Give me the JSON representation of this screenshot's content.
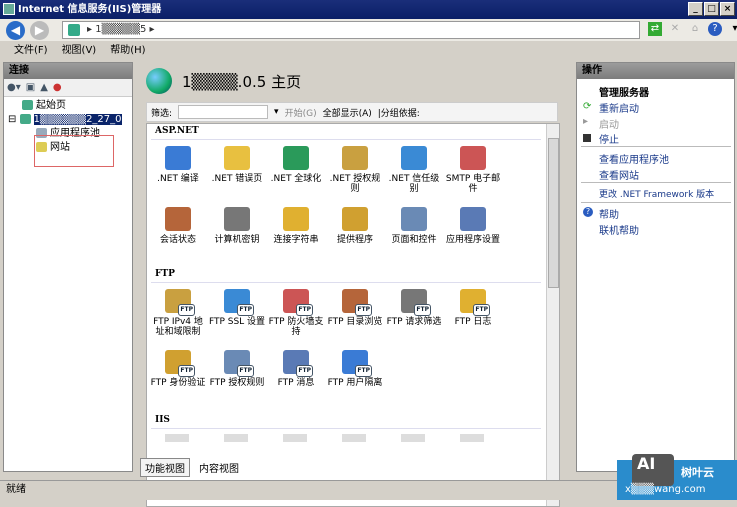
{
  "window": {
    "title": "Internet 信息服务(IIS)管理器",
    "minimize": "_",
    "maximize": "□",
    "close": "×"
  },
  "address": {
    "path": "1▒▒▒▒▒5 ▸"
  },
  "menu": [
    "文件(F)",
    "视图(V)",
    "帮助(H)"
  ],
  "left": {
    "header": "连接",
    "tree": [
      "起始页",
      "1▒▒▒▒▒▒2_27_0",
      "应用程序池",
      "网站"
    ]
  },
  "center": {
    "title": "1▒▒▒▒.0.5 主页",
    "filter_label": "筛选:",
    "start": "开始(G)",
    "show_all": "全部显示(A)",
    "group_by": "|分组依据:",
    "sections": [
      {
        "name": "ASP.NET",
        "items": [
          ".NET 编译",
          ".NET 错误页",
          ".NET 全球化",
          ".NET 授权规则",
          ".NET 信任级别",
          "SMTP 电子邮件",
          "会话状态",
          "计算机密钥",
          "连接字符串",
          "提供程序",
          "页面和控件",
          "应用程序设置"
        ]
      },
      {
        "name": "FTP",
        "items": [
          "FTP IPv4 地址和域限制",
          "FTP SSL 设置",
          "FTP 防火墙支持",
          "FTP 目录浏览",
          "FTP 请求筛选",
          "FTP 日志",
          "FTP 身份验证",
          "FTP 授权规则",
          "FTP 消息",
          "FTP 用户隔离"
        ]
      },
      {
        "name": "IIS",
        "items": []
      }
    ],
    "tabs": [
      "功能视图",
      "内容视图"
    ]
  },
  "right": {
    "header": "操作",
    "group": "管理服务器",
    "actions": [
      "重新启动",
      "启动",
      "停止",
      "查看应用程序池",
      "查看网站",
      "更改 .NET Framework 版本",
      "帮助",
      "联机帮助"
    ]
  },
  "status": "就绪",
  "watermark": {
    "logo": "AI",
    "brand": "树叶云",
    "url": "x▒▒▒wang.com"
  }
}
